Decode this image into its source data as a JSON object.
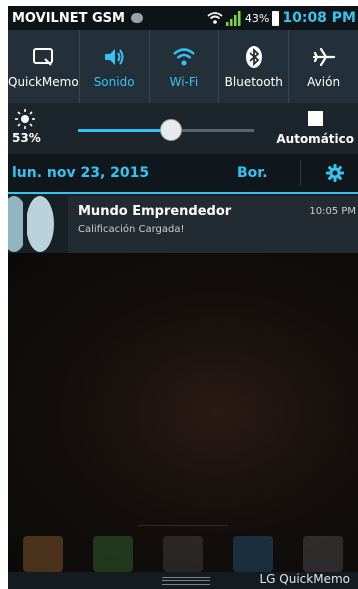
{
  "status_bar": {
    "carrier": "MOVILNET GSM",
    "battery_percent": "43%",
    "time": "10:08 PM",
    "icons": [
      "message-icon",
      "wifi-icon",
      "signal-icon",
      "battery-icon"
    ]
  },
  "quick_settings": {
    "tiles": [
      {
        "label": "QuickMemo",
        "icon": "quickmemo-icon",
        "active": false
      },
      {
        "label": "Sonido",
        "icon": "sound-icon",
        "active": true
      },
      {
        "label": "Wi-Fi",
        "icon": "wifi-icon",
        "active": true
      },
      {
        "label": "Bluetooth",
        "icon": "bluetooth-icon",
        "active": false
      },
      {
        "label": "Avión",
        "icon": "airplane-icon",
        "active": false
      }
    ]
  },
  "brightness": {
    "percent_label": "53%",
    "level": 0.53,
    "auto_label": "Automático",
    "auto_checked": false
  },
  "date_bar": {
    "date": "lun. nov 23, 2015",
    "clear_label": "Bor.",
    "settings_icon": "gear-icon"
  },
  "notifications": [
    {
      "title": "Mundo Emprendedor",
      "text": "Calificación Cargada!",
      "time": "10:05 PM"
    }
  ],
  "footer": {
    "label": "LG QuickMemo"
  },
  "colors": {
    "accent": "#35c3f2",
    "panel": "#243039",
    "status_bg": "#0d1418"
  }
}
